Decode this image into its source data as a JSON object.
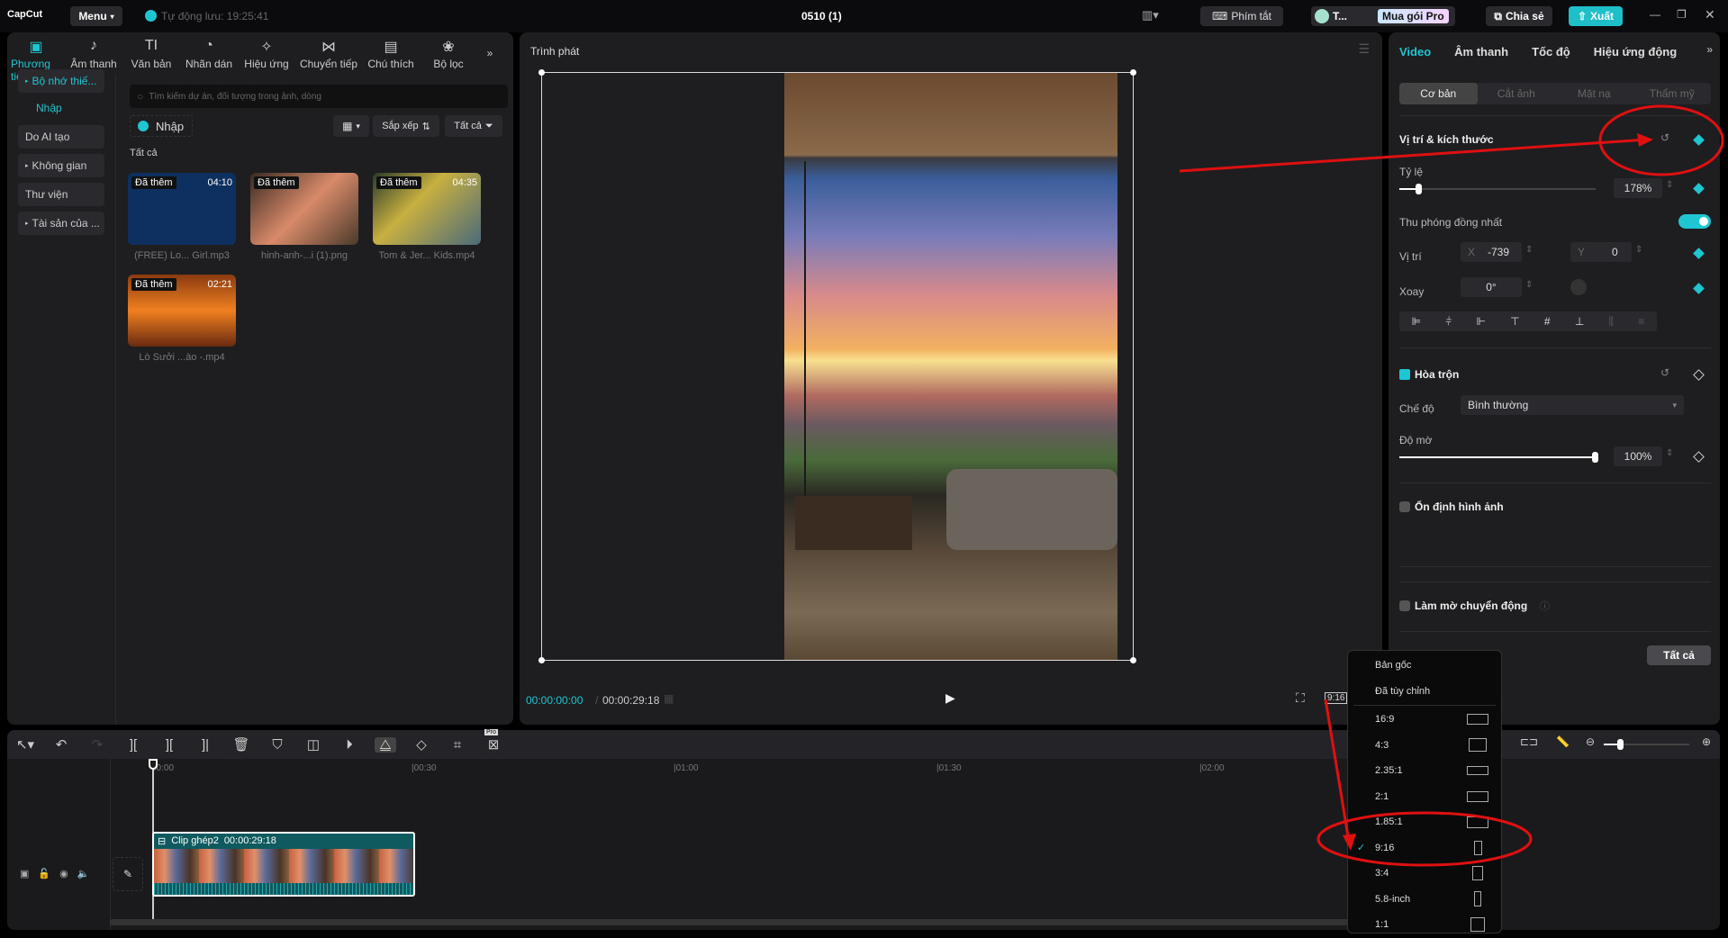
{
  "app": {
    "logo": "CapCut",
    "menu": "Menu",
    "autosave": "Tự động lưu: 19:25:41",
    "project_title": "0510 (1)"
  },
  "topbar": {
    "shortcuts": "Phím tắt",
    "user": "T...",
    "pro": "Mua gói Pro",
    "share": "Chia sẻ",
    "export": "Xuất"
  },
  "media_tabs": [
    {
      "label": "Phương tiện",
      "icon": "media-icon"
    },
    {
      "label": "Âm thanh",
      "icon": "audio-icon"
    },
    {
      "label": "Văn bản",
      "icon": "text-icon"
    },
    {
      "label": "Nhãn dán",
      "icon": "sticker-icon"
    },
    {
      "label": "Hiệu ứng",
      "icon": "effects-icon"
    },
    {
      "label": "Chuyển tiếp",
      "icon": "transition-icon"
    },
    {
      "label": "Chú thích",
      "icon": "caption-icon"
    },
    {
      "label": "Bộ lọc",
      "icon": "filter-icon"
    }
  ],
  "sidebar": {
    "items": [
      "Bộ nhớ thiế...",
      "Nhập",
      "Do AI tạo",
      "Không gian",
      "Thư viện",
      "Tài sản của ..."
    ]
  },
  "media": {
    "search_placeholder": "Tìm kiếm dự án, đối tượng trong ảnh, dòng",
    "import": "Nhập",
    "sort": "Sắp xếp",
    "filter": "Tất cả",
    "section": "Tất cả",
    "items": [
      {
        "badge": "Đã thêm",
        "duration": "04:10",
        "name": "(FREE) Lo... Girl.mp3"
      },
      {
        "badge": "Đã thêm",
        "duration": "",
        "name": "hinh-anh-...i (1).png"
      },
      {
        "badge": "Đã thêm",
        "duration": "04:35",
        "name": "Tom & Jer... Kids.mp4"
      },
      {
        "badge": "Đã thêm",
        "duration": "02:21",
        "name": "Lò Sưởi ...ào -.mp4"
      }
    ]
  },
  "player": {
    "title": "Trình phát",
    "current_time": "00:00:00:00",
    "total_time": "00:00:29:18",
    "ratio_button": "9:16"
  },
  "ratio_menu": {
    "items": [
      "Bản gốc",
      "Đã tùy chỉnh",
      "16:9",
      "4:3",
      "2.35:1",
      "2:1",
      "1.85:1",
      "9:16",
      "3:4",
      "5.8-inch",
      "1:1"
    ],
    "selected": "9:16"
  },
  "right": {
    "tabs": [
      "Video",
      "Âm thanh",
      "Tốc độ",
      "Hiệu ứng động"
    ],
    "subtabs": [
      "Cơ bản",
      "Cắt ảnh",
      "Mặt nạ",
      "Thẩm mỹ"
    ],
    "position_size": {
      "title": "Vị trí & kích thước",
      "scale_label": "Tỷ lệ",
      "scale_value": "178%",
      "scale_fraction": 0.1,
      "uniform_label": "Thu phóng đồng nhất",
      "uniform_on": true,
      "pos_label": "Vị trí",
      "x_label": "X",
      "x_value": "-739",
      "y_label": "Y",
      "y_value": "0",
      "rotate_label": "Xoay",
      "rotate_value": "0°"
    },
    "blend": {
      "title": "Hòa trộn",
      "checked": true,
      "mode_label": "Chế độ",
      "mode_value": "Bình thường",
      "opacity_label": "Độ mờ",
      "opacity_value": "100%",
      "opacity_fraction": 1.0
    },
    "stabilize": {
      "title": "Ổn định hình ảnh",
      "checked": false
    },
    "motion_blur": {
      "title": "Làm mờ chuyển động",
      "checked": false
    },
    "apply_all": "Tất cả"
  },
  "timeline": {
    "ticks": [
      "00:00",
      "|00:30",
      "|01:00",
      "|01:30",
      "|02:00"
    ],
    "clip_name": "Clip ghép2",
    "clip_duration": "00:00:29:18",
    "pro_badge": "Pro"
  },
  "colors": {
    "accent": "#1fc5d0",
    "annotation": "#e01010",
    "clip": "#0e5a5e"
  }
}
